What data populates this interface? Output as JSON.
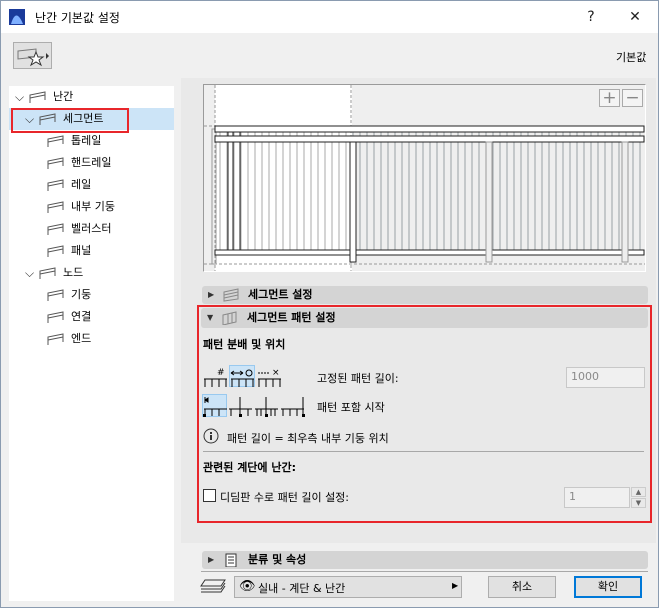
{
  "window": {
    "title": "난간 기본값 설정",
    "help": "?",
    "close": "✕"
  },
  "header": {
    "defaults_label": "기본값"
  },
  "tree": {
    "items": [
      {
        "label": "난간",
        "level": 0,
        "expanded": true,
        "icon": "railing-icon"
      },
      {
        "label": "세그먼트",
        "level": 1,
        "expanded": true,
        "selected": true,
        "icon": "segment-icon"
      },
      {
        "label": "톱레일",
        "level": 2,
        "icon": "toprail-icon"
      },
      {
        "label": "핸드레일",
        "level": 2,
        "icon": "handrail-icon"
      },
      {
        "label": "레일",
        "level": 2,
        "icon": "rail-icon"
      },
      {
        "label": "내부 기둥",
        "level": 2,
        "icon": "inner-post-icon"
      },
      {
        "label": "벨러스터",
        "level": 2,
        "icon": "baluster-icon"
      },
      {
        "label": "패널",
        "level": 2,
        "icon": "panel-icon"
      },
      {
        "label": "노드",
        "level": 1,
        "expanded": true,
        "icon": "node-icon"
      },
      {
        "label": "기둥",
        "level": 2,
        "icon": "post-icon"
      },
      {
        "label": "연결",
        "level": 2,
        "icon": "connection-icon"
      },
      {
        "label": "엔드",
        "level": 2,
        "icon": "end-icon"
      }
    ]
  },
  "preview": {
    "zoom_in": "+",
    "zoom_out": "−"
  },
  "sections": {
    "segment_settings": "세그먼트 설정",
    "pattern_settings": "세그먼트 패턴 설정",
    "classification": "분류 및 속성"
  },
  "pattern": {
    "distribution_heading": "패턴 분배 및 위치",
    "fixed_length_label": "고정된 패턴 길이:",
    "fixed_length_value": "1000",
    "start_label": "패턴 포함 시작",
    "info_text": "패턴 길이 = 최우측 내부 기둥 위치",
    "stair_heading": "관련된 계단에 난간:",
    "tread_checkbox_label": "디딤판 수로 패턴 길이 설정:",
    "tread_checked": false,
    "tread_value": "1",
    "distribution_selected": 1,
    "start_selected": 0
  },
  "footer": {
    "layer_value": "실내 - 계단 & 난간",
    "cancel": "취소",
    "ok": "확인"
  }
}
